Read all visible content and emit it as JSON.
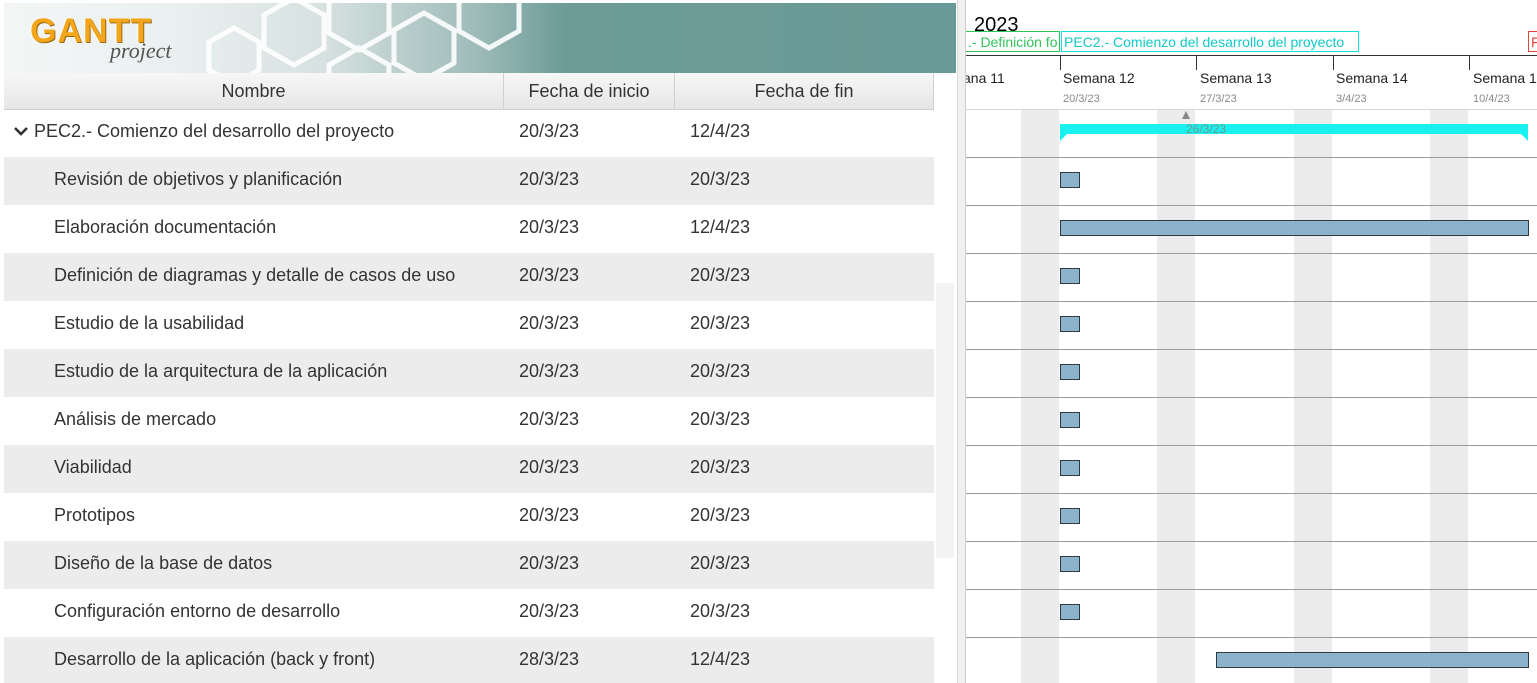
{
  "logo": {
    "word": "GANTT",
    "sub": "project"
  },
  "table": {
    "headers": {
      "name": "Nombre",
      "start": "Fecha de inicio",
      "end": "Fecha de fin"
    },
    "rows": [
      {
        "name": "PEC2.- Comienzo del desarrollo del proyecto",
        "start": "20/3/23",
        "end": "12/4/23"
      },
      {
        "name": "Revisión de objetivos y planificación",
        "start": "20/3/23",
        "end": "20/3/23"
      },
      {
        "name": "Elaboración documentación",
        "start": "20/3/23",
        "end": "12/4/23"
      },
      {
        "name": "Definición de diagramas y detalle de casos de uso",
        "start": "20/3/23",
        "end": "20/3/23"
      },
      {
        "name": "Estudio de la usabilidad",
        "start": "20/3/23",
        "end": "20/3/23"
      },
      {
        "name": "Estudio de la arquitectura de la aplicación",
        "start": "20/3/23",
        "end": "20/3/23"
      },
      {
        "name": "Análisis de mercado",
        "start": "20/3/23",
        "end": "20/3/23"
      },
      {
        "name": "Viabilidad",
        "start": "20/3/23",
        "end": "20/3/23"
      },
      {
        "name": "Prototipos",
        "start": "20/3/23",
        "end": "20/3/23"
      },
      {
        "name": "Diseño de la base de datos",
        "start": "20/3/23",
        "end": "20/3/23"
      },
      {
        "name": "Configuración entorno de desarrollo",
        "start": "20/3/23",
        "end": "20/3/23"
      },
      {
        "name": "Desarrollo de la aplicación (back y front)",
        "start": "28/3/23",
        "end": "12/4/23"
      }
    ]
  },
  "chart": {
    "year": "2023",
    "timeline_labels": [
      {
        "text": ".- Definición fo"
      },
      {
        "text": "PEC2.- Comienzo del desarrollo del proyecto"
      },
      {
        "text": "F"
      }
    ],
    "weeks": [
      {
        "name": "ana 11",
        "date": ""
      },
      {
        "name": "Semana 12",
        "date": "20/3/23"
      },
      {
        "name": "Semana 13",
        "date": "27/3/23"
      },
      {
        "name": "Semana 14",
        "date": "3/4/23"
      },
      {
        "name": "Semana 1",
        "date": "10/4/23"
      }
    ],
    "today_label": "26/3/23",
    "colors": {
      "task_bar": "#8db2cc",
      "summary_bar": "#19f1f1",
      "milestone_green": "#2ec55a",
      "milestone_red": "#e0443a"
    }
  }
}
